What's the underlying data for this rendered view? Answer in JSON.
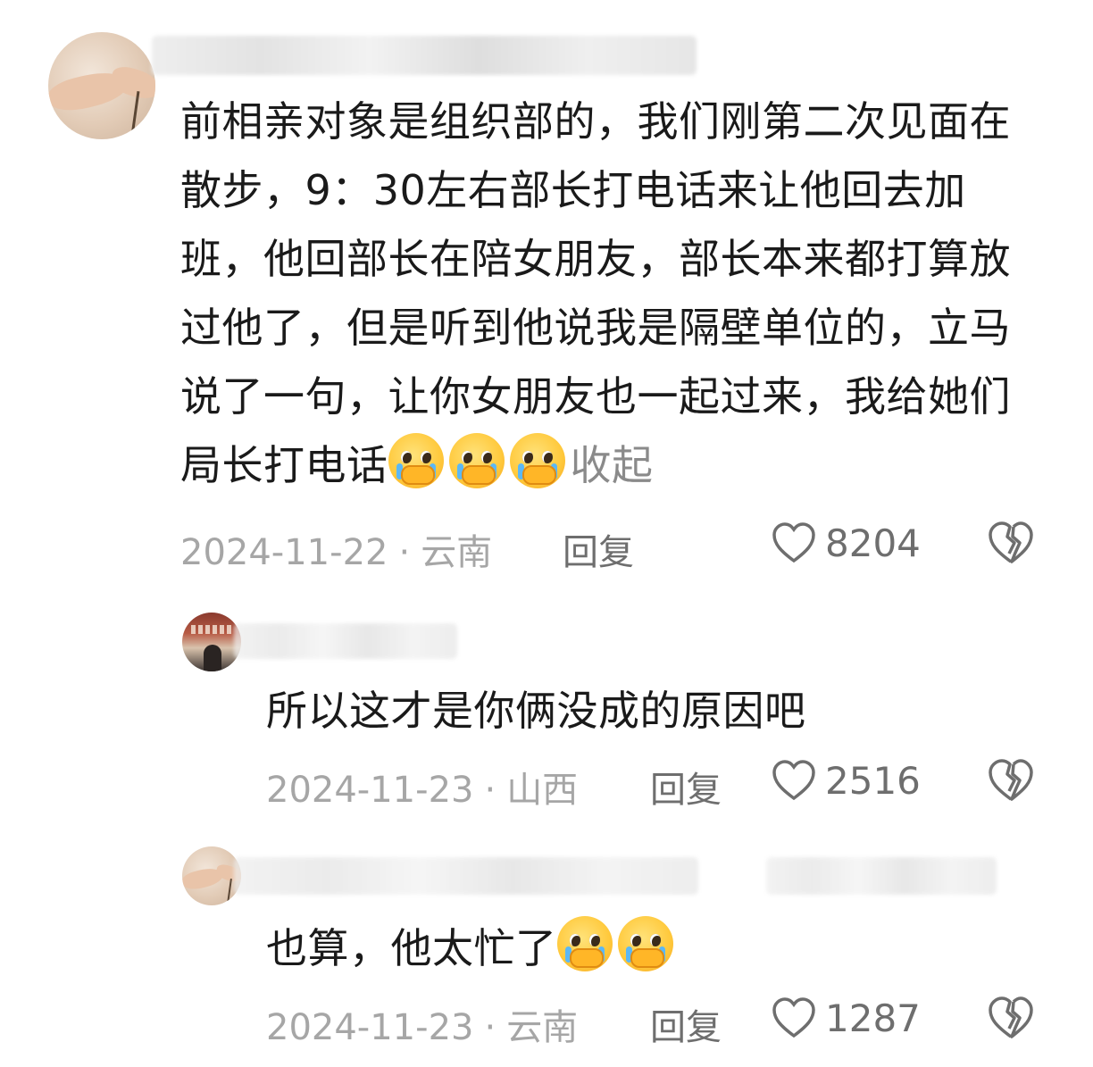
{
  "comments": [
    {
      "avatar_icon": "hand-thread-avatar",
      "text": "前相亲对象是组织部的，我们刚第二次见面在散步，9：30左右部长打电话来让他回去加班，他回部长在陪女朋友，部长本来都打算放过他了，但是听到他说我是隔壁单位的，立马说了一句，让你女朋友也一起过来，我给她们局长打电话",
      "emoji_count": 3,
      "collapse_label": "收起",
      "date": "2024-11-22",
      "location": "云南",
      "reply_label": "回复",
      "likes": "8204"
    },
    {
      "avatar_icon": "poster-avatar",
      "text": "所以这才是你俩没成的原因吧",
      "emoji_count": 0,
      "date": "2024-11-23",
      "location": "山西",
      "reply_label": "回复",
      "likes": "2516"
    },
    {
      "avatar_icon": "hand-thread-avatar",
      "text": "也算，他太忙了",
      "emoji_count": 2,
      "date": "2024-11-23",
      "location": "云南",
      "reply_label": "回复",
      "likes": "1287"
    }
  ],
  "separator": "·",
  "icons": {
    "like": "heart-outline-icon",
    "dislike": "broken-heart-icon",
    "emoji": "crying-pleading-emoji"
  },
  "colors": {
    "text": "#1a1a1a",
    "meta": "#a6a6a6",
    "action": "#6e6e6e"
  }
}
